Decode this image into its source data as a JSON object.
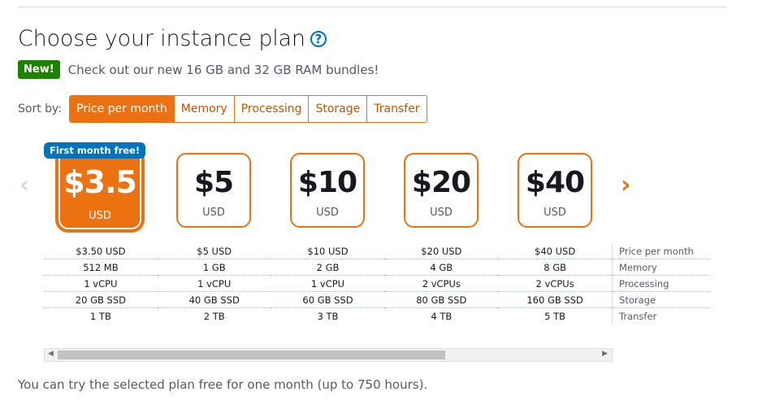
{
  "page": {
    "title": "Choose your instance plan",
    "help_icon": "question-circle-icon"
  },
  "banner": {
    "badge": "New!",
    "text": "Check out our new 16 GB and 32 GB RAM bundles!"
  },
  "sort": {
    "label": "Sort by:",
    "options": [
      "Price per month",
      "Memory",
      "Processing",
      "Storage",
      "Transfer"
    ],
    "selected": "Price per month"
  },
  "carousel": {
    "prev_icon": "chevron-left-icon",
    "next_icon": "chevron-right-icon"
  },
  "plans": [
    {
      "price": "$3.5",
      "currency": "USD",
      "badge": "First month free!",
      "selected": true,
      "price_per_month": "$3.50 USD",
      "memory": "512 MB",
      "processing": "1 vCPU",
      "storage": "20 GB SSD",
      "transfer": "1 TB"
    },
    {
      "price": "$5",
      "currency": "USD",
      "selected": false,
      "price_per_month": "$5 USD",
      "memory": "1 GB",
      "processing": "1 vCPU",
      "storage": "40 GB SSD",
      "transfer": "2 TB"
    },
    {
      "price": "$10",
      "currency": "USD",
      "selected": false,
      "price_per_month": "$10 USD",
      "memory": "2 GB",
      "processing": "1 vCPU",
      "storage": "60 GB SSD",
      "transfer": "3 TB"
    },
    {
      "price": "$20",
      "currency": "USD",
      "selected": false,
      "price_per_month": "$20 USD",
      "memory": "4 GB",
      "processing": "2 vCPUs",
      "storage": "80 GB SSD",
      "transfer": "4 TB"
    },
    {
      "price": "$40",
      "currency": "USD",
      "selected": false,
      "price_per_month": "$40 USD",
      "memory": "8 GB",
      "processing": "2 vCPUs",
      "storage": "160 GB SSD",
      "transfer": "5 TB"
    }
  ],
  "spec_labels": {
    "price_per_month": "Price per month",
    "memory": "Memory",
    "processing": "Processing",
    "storage": "Storage",
    "transfer": "Transfer"
  },
  "scrollbar": {
    "left_icon": "scroll-left-arrow-icon",
    "right_icon": "scroll-right-arrow-icon"
  },
  "footer": {
    "note": "You can try the selected plan free for one month (up to 750 hours)."
  },
  "colors": {
    "accent": "#ec7211",
    "link": "#0073bb",
    "success": "#1d8102"
  }
}
